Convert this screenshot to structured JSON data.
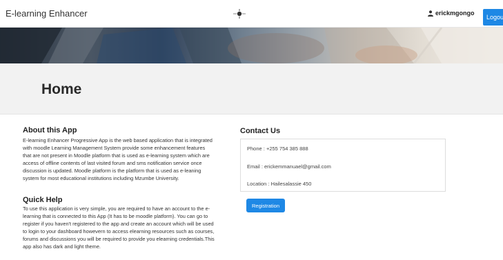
{
  "navbar": {
    "brand": "E-learning Enhancer",
    "username": "erickmgongo",
    "logout_label": "Logout",
    "logo_icon": "sun-logo-icon",
    "user_icon": "user-icon"
  },
  "main": {
    "title": "Home"
  },
  "about": {
    "heading": "About this App",
    "lines": [
      "E-learning Enhancer Progressive App is the web based application that is integrated",
      "with moodle Learning Management System provide some enhancement features",
      "that are not present in Moodle platform that is used as e-learning system which are",
      "access of offline contents of last visited forum and sms notification service once",
      "discussion is updated. Moodle platform is the platform that is used as e-leaning",
      "system for most educational institutions including Mzumbe University."
    ]
  },
  "quick_help": {
    "heading": "Quick Help",
    "lines": [
      "To use this application is very simple, you are required to have an account to the e-",
      "learning that is connected to this App (It has to be moodle platform). You can go to",
      "register if you haven't registered to the app and create an account which will be used",
      "to login to your dashboard howevern to access elearning resources such as courses,",
      "forums and discussions you will be required to provide you elearning credentials.This",
      "app also has dark and light theme."
    ]
  },
  "contact": {
    "heading": "Contact Us",
    "phone": "Phone : +255 754 385 888",
    "email": "Email : erickemmanuael@gmail.com",
    "location": "Location : Hailesalassie 450",
    "register_label": "Registration"
  },
  "colors": {
    "primary": "#1e88e5",
    "band": "#f2f2f2"
  }
}
